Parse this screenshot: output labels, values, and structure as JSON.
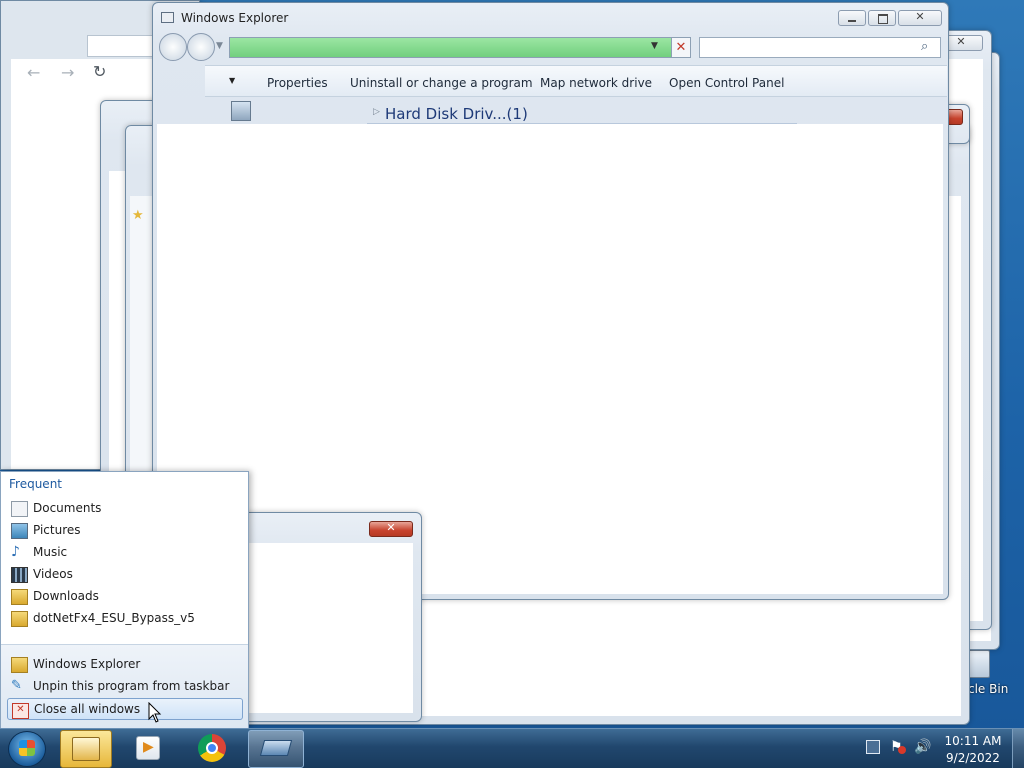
{
  "explorer": {
    "title": "Windows Explorer",
    "toolbar": [
      "Properties",
      "Uninstall or change a program",
      "Map network drive",
      "Open Control Panel"
    ],
    "section_header": "Hard Disk Driv...(1)"
  },
  "jumplist": {
    "frequent_label": "Frequent",
    "frequent": [
      {
        "label": "Documents",
        "icon": "document-icon"
      },
      {
        "label": "Pictures",
        "icon": "pictures-icon"
      },
      {
        "label": "Music",
        "icon": "music-icon"
      },
      {
        "label": "Videos",
        "icon": "videos-icon"
      },
      {
        "label": "Downloads",
        "icon": "folder-icon"
      },
      {
        "label": "dotNetFx4_ESU_Bypass_v5",
        "icon": "folder-icon"
      }
    ],
    "tasks": [
      {
        "label": "Windows Explorer",
        "icon": "explorer-icon"
      },
      {
        "label": "Unpin this program from taskbar",
        "icon": "unpin-icon"
      },
      {
        "label": "Close all windows",
        "icon": "close-windows-icon"
      }
    ]
  },
  "desktop": {
    "recycle_label": "cle Bin"
  },
  "taskbar": {
    "time": "10:11 AM",
    "date": "9/2/2022"
  },
  "colors": {
    "taskbar": "#1b3f63",
    "address_bar": "#7ed98a",
    "highlight": "#cfe3f8"
  }
}
